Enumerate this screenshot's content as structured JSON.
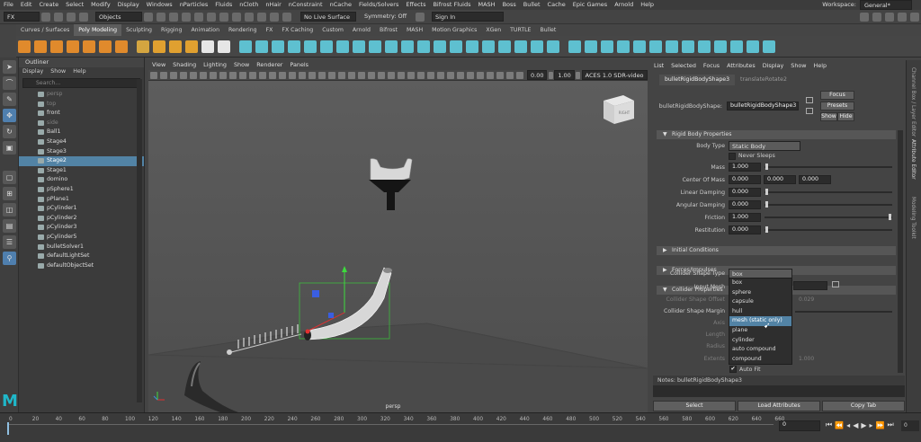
{
  "menubar": {
    "items": [
      "File",
      "Edit",
      "Create",
      "Select",
      "Modify",
      "Display",
      "Windows",
      "nParticles",
      "Fluids",
      "nCloth",
      "nHair",
      "nConstraint",
      "nCache",
      "Fields/Solvers",
      "Effects",
      "Bifrost Fluids",
      "MASH",
      "Boss",
      "Bullet",
      "Cache",
      "Epic Games",
      "Arnold",
      "Help"
    ],
    "workspace_label": "Workspace:",
    "workspace_value": "General*"
  },
  "statusline": {
    "menu_set": "FX",
    "select_mode": "Objects",
    "live_surface": "No Live Surface",
    "symmetry": "Symmetry: Off",
    "sign_in": "Sign In"
  },
  "shelf": {
    "tabs": [
      "Curves / Surfaces",
      "Poly Modeling",
      "Sculpting",
      "Rigging",
      "Animation",
      "Rendering",
      "FX",
      "FX Caching",
      "Custom",
      "Arnold",
      "Bifrost",
      "MASH",
      "Motion Graphics",
      "XGen",
      "TURTLE",
      "Bullet"
    ],
    "active_tab": "Poly Modeling",
    "icon_colors": [
      "#e08a2c",
      "#e08a2c",
      "#e08a2c",
      "#e08a2c",
      "#e08a2c",
      "#e08a2c",
      "#e08a2c",
      "#d4a540",
      "#e0a030",
      "#e0a030",
      "#e0a030",
      "#e6e6e6",
      "#e6e6e6",
      "#5ec0d0",
      "#5ec0d0",
      "#5ec0d0",
      "#5ec0d0",
      "#5ec0d0",
      "#5ec0d0",
      "#5ec0d0",
      "#5ec0d0",
      "#5ec0d0",
      "#5ec0d0",
      "#5ec0d0",
      "#5ec0d0",
      "#5ec0d0",
      "#5ec0d0",
      "#5ec0d0",
      "#5ec0d0",
      "#5ec0d0",
      "#5ec0d0",
      "#5ec0d0",
      "#5ec0d0",
      "#5ec0d0",
      "#5ec0d0",
      "#5ec0d0",
      "#5ec0d0",
      "#5ec0d0",
      "#5ec0d0",
      "#5ec0d0",
      "#5ec0d0",
      "#5ec0d0",
      "#5ec0d0",
      "#5ec0d0",
      "#5ec0d0",
      "#5ec0d0"
    ]
  },
  "outliner": {
    "title": "Outliner",
    "menu": [
      "Display",
      "Show",
      "Help"
    ],
    "search_placeholder": "Search...",
    "items": [
      {
        "label": "persp",
        "state": "dim"
      },
      {
        "label": "top",
        "state": "dim"
      },
      {
        "label": "front",
        "state": ""
      },
      {
        "label": "side",
        "state": "dim"
      },
      {
        "label": "Ball1",
        "state": ""
      },
      {
        "label": "Stage4",
        "state": ""
      },
      {
        "label": "Stage3",
        "state": ""
      },
      {
        "label": "Stage2",
        "state": "sel"
      },
      {
        "label": "Stage1",
        "state": ""
      },
      {
        "label": "domino",
        "state": ""
      },
      {
        "label": "pSphere1",
        "state": ""
      },
      {
        "label": "pPlane1",
        "state": ""
      },
      {
        "label": "pCylinder1",
        "state": ""
      },
      {
        "label": "pCylinder2",
        "state": ""
      },
      {
        "label": "pCylinder3",
        "state": ""
      },
      {
        "label": "pCylinder5",
        "state": ""
      },
      {
        "label": "bulletSolver1",
        "state": ""
      },
      {
        "label": "defaultLightSet",
        "state": ""
      },
      {
        "label": "defaultObjectSet",
        "state": ""
      }
    ]
  },
  "viewport": {
    "menu": [
      "View",
      "Shading",
      "Lighting",
      "Show",
      "Renderer",
      "Panels"
    ],
    "value_a": "0.00",
    "value_b": "1.00",
    "color_space": "ACES 1.0 SDR-video (sRGB)",
    "camera_label": "persp",
    "view_cube_label": "RIGHT"
  },
  "attribute_editor": {
    "menu": [
      "List",
      "Selected",
      "Focus",
      "Attributes",
      "Display",
      "Show",
      "Help"
    ],
    "tabs": [
      "bulletRigidBodyShape3",
      "translateRotate2"
    ],
    "node_label": "bulletRigidBodyShape:",
    "node_value": "bulletRigidBodyShape3",
    "focus": "Focus",
    "presets": "Presets",
    "show": "Show",
    "hide": "Hide",
    "sec_rigid": "Rigid Body Properties",
    "body_type_label": "Body Type",
    "body_type_value": "Static Body",
    "never_sleeps": "Never Sleeps",
    "mass_label": "Mass",
    "mass_value": "1.000",
    "com_label": "Center Of Mass",
    "com_values": [
      "0.000",
      "0.000",
      "0.000"
    ],
    "lin_damp_label": "Linear Damping",
    "lin_damp_value": "0.000",
    "ang_damp_label": "Angular Damping",
    "ang_damp_value": "0.000",
    "friction_label": "Friction",
    "friction_value": "1.000",
    "restitution_label": "Restitution",
    "restitution_value": "0.000",
    "sec_initial": "Initial Conditions",
    "sec_forces": "Forces/Impulses",
    "sec_collider": "Collider Properties",
    "shape_type_label": "Collider Shape Type",
    "shape_type_value": "box",
    "input_mesh_label": "Input Mesh",
    "shape_offset_label": "Collider Shape Offset",
    "shape_offset_value": "0.029",
    "shape_margin_label": "Collider Shape Margin",
    "axis_label": "Axis",
    "length_label": "Length",
    "radius_label": "Radius",
    "extents_label": "Extents",
    "extents_value": "1.000",
    "auto_fit": "Auto Fit",
    "dropdown_options": [
      "box",
      "sphere",
      "capsule",
      "hull",
      "mesh (static only)",
      "plane",
      "cylinder",
      "auto compound",
      "compound"
    ],
    "dropdown_highlight": "mesh (static only)",
    "notes_label": "Notes:",
    "notes_value": "bulletRigidBodyShape3",
    "select_btn": "Select",
    "load_btn": "Load Attributes",
    "copy_btn": "Copy Tab"
  },
  "right_sidebar": [
    "Channel Box / Layer Editor",
    "Attribute Editor",
    "Modeling Toolkit"
  ],
  "timeline": {
    "ticks": [
      "0",
      "20",
      "40",
      "60",
      "80",
      "100",
      "120",
      "140",
      "160",
      "180",
      "200",
      "220",
      "240",
      "260",
      "280",
      "300",
      "320",
      "340",
      "360",
      "380",
      "400",
      "420",
      "440",
      "460",
      "480",
      "500",
      "520",
      "540",
      "560",
      "580",
      "600",
      "620",
      "640",
      "660"
    ],
    "current_frame": "0",
    "current_frame_right": "0"
  },
  "maya_logo": "M"
}
